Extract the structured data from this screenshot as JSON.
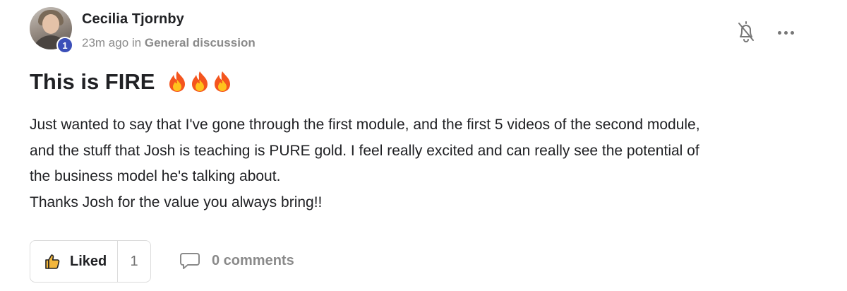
{
  "post": {
    "author": {
      "name": "Cecilia Tjornby",
      "level": "1",
      "avatar_icon": "avatar-photo"
    },
    "meta": {
      "time": "23m ago",
      "in_word": "in",
      "category": "General discussion"
    },
    "actions": {
      "bell_icon": "bell-off-icon",
      "more_icon": "more-horizontal-icon"
    },
    "title": "This is FIRE",
    "title_emoji_icon": "fire-icon",
    "title_emoji_count": 3,
    "body": [
      "Just wanted to say that I've gone through the first module, and the first 5 videos of the second module,",
      "and the stuff that Josh is teaching is PURE gold. I feel really excited and can really see the potential of",
      "the business model he's talking about.",
      "Thanks Josh for the value you always bring!!"
    ],
    "footer": {
      "like_label": "Liked",
      "like_count": "1",
      "comments_label": "0 comments"
    }
  },
  "colors": {
    "text": "#202124",
    "muted": "#8a8a8a",
    "badge": "#3b4fb8",
    "border": "#dcdcdc"
  }
}
